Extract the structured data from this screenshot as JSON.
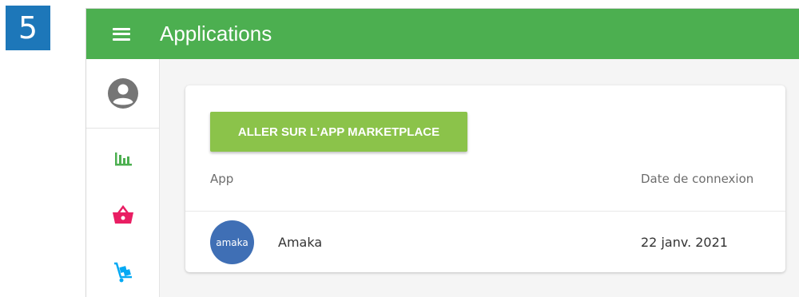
{
  "step_badge": "5",
  "header": {
    "title": "Applications",
    "menu_icon": "hamburger-menu-icon",
    "background_color": "#4caf50"
  },
  "sidebar": {
    "items": [
      {
        "icon": "account-circle-icon",
        "color": "#757575"
      },
      {
        "icon": "bar-chart-icon",
        "color": "#4caf50"
      },
      {
        "icon": "shopping-basket-icon",
        "color": "#e91e63"
      },
      {
        "icon": "hand-truck-icon",
        "color": "#03a9f4"
      }
    ]
  },
  "main": {
    "marketplace_button_label": "ALLER SUR L’APP MARKETPLACE",
    "button_color": "#8bc34a",
    "table": {
      "columns": [
        "App",
        "Date de connexion"
      ],
      "rows": [
        {
          "logo_text": "amaka",
          "name": "Amaka",
          "date": "22 janv. 2021"
        }
      ]
    }
  }
}
